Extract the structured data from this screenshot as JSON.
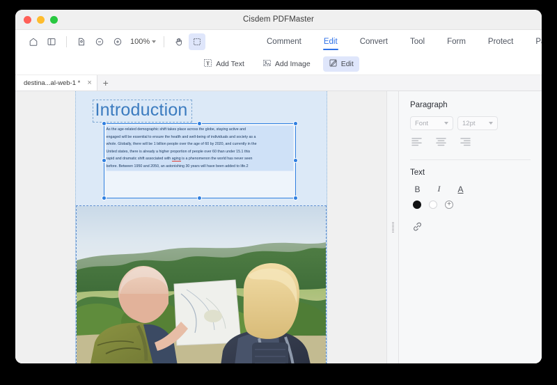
{
  "window": {
    "title": "Cisdem PDFMaster",
    "traffic_lights": [
      "close-red",
      "minimize-yellow",
      "maximize-green"
    ]
  },
  "toolbar": {
    "left_buttons": [
      {
        "name": "home-icon",
        "label": "Home"
      },
      {
        "name": "sidebar-toggle-icon",
        "label": "Sidebar"
      },
      {
        "name": "page-fit-icon",
        "label": "Fit Page"
      },
      {
        "name": "zoom-out-icon",
        "label": "Zoom Out"
      },
      {
        "name": "zoom-in-icon",
        "label": "Zoom In"
      },
      {
        "name": "hand-tool-icon",
        "label": "Hand Tool"
      },
      {
        "name": "select-area-icon",
        "label": "Select Area"
      }
    ],
    "zoom_level": "100%",
    "tabs": [
      {
        "label": "Comment",
        "active": false
      },
      {
        "label": "Edit",
        "active": true
      },
      {
        "label": "Convert",
        "active": false
      },
      {
        "label": "Tool",
        "active": false
      },
      {
        "label": "Form",
        "active": false
      },
      {
        "label": "Protect",
        "active": false
      },
      {
        "label": "Page",
        "active": false
      }
    ],
    "active_tab": "Edit",
    "accent_color": "#2f72e8",
    "selected_bg": "#dfe6fb"
  },
  "subbar": {
    "buttons": [
      {
        "label": "Add Text",
        "icon": "add-text-icon",
        "selected": false
      },
      {
        "label": "Add Image",
        "icon": "add-image-icon",
        "selected": false
      },
      {
        "label": "Edit",
        "icon": "edit-pencil-icon",
        "selected": true
      }
    ]
  },
  "tabstrip": {
    "documents": [
      {
        "label": "destina...al-web-1 *",
        "close": "×"
      }
    ],
    "new_tab": "+"
  },
  "document": {
    "heading": "Introduction",
    "heading_color": "#3b7bbf",
    "paragraph_lines": [
      "As the age-related demographic shift takes place across the globe, staying active and",
      "engaged will be essential to ensure the health and well-being of individuals and society as a",
      "whole. Globally, there will be 1 billion people over the age of 60 by 2020, and currently in the",
      "United states, there is already a higher proportion of people over 60 than under 15.1 this",
      "rapid and dramatic shift associated with %%aging%% is a phenomenon the world has never seen",
      "before. Between 1950 and 2050, an astonishing 30 years will have been added to life.2"
    ],
    "misspelled_word": "aging",
    "selection_handle_color": "#2f7fe0",
    "image_alt": "Two older adults with backpacks reading a map in a green countryside landscape"
  },
  "right_panel": {
    "paragraph_section": {
      "title": "Paragraph",
      "font_select": {
        "value": "Font",
        "placeholder": "Font"
      },
      "size_select": {
        "value": "12pt",
        "placeholder": "12pt"
      },
      "align_buttons": [
        {
          "name": "align-left-icon",
          "label": "Align Left"
        },
        {
          "name": "align-center-icon",
          "label": "Align Center"
        },
        {
          "name": "align-right-icon",
          "label": "Align Right"
        }
      ]
    },
    "text_section": {
      "title": "Text",
      "styles": [
        {
          "name": "bold-button",
          "label": "B"
        },
        {
          "name": "italic-button",
          "label": "I"
        },
        {
          "name": "underline-button",
          "label": "A"
        }
      ],
      "colors": [
        {
          "name": "color-swatch-black",
          "hex": "#111214",
          "selected": true
        },
        {
          "name": "color-swatch-white",
          "hex": "#ffffff",
          "selected": false
        },
        {
          "name": "color-swatch-add",
          "label": "+"
        }
      ],
      "link_button": {
        "name": "link-icon",
        "label": "Link"
      }
    }
  }
}
